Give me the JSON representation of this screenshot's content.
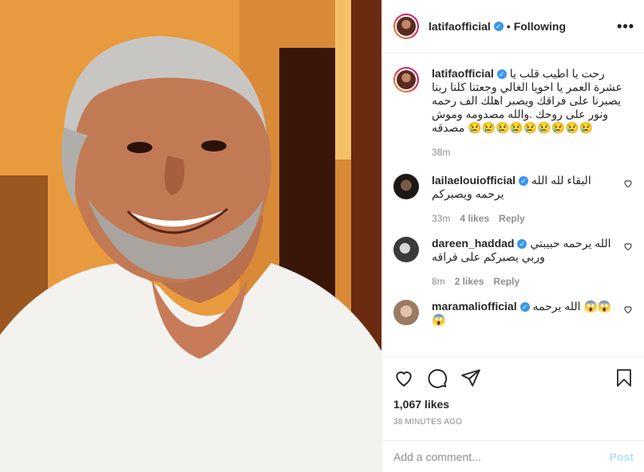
{
  "photo": {
    "description_icon": "person-photo"
  },
  "header": {
    "username": "latifaofficial",
    "verified": true,
    "separator": "•",
    "follow_label": "Following",
    "more_icon": "more-icon"
  },
  "caption": {
    "username": "latifaofficial",
    "text": "رحت يا اطيب قلب يا عشرة العمر يا اخويا الغالي وجعتنا كلنا ربنا يصبرنا على فراقك ويصبر اهلك الف رحمه ونور على روحك .والله مصدومه وموش مصدقه 😢😢😢😢😢😢😢😢😢",
    "time": "38m"
  },
  "comments": [
    {
      "username": "lailaelouiofficial",
      "text": "البقاء لله الله يرحمه ويصبركم",
      "time": "33m",
      "likes": "4 likes",
      "reply": "Reply",
      "avatar_color": "#2b2520"
    },
    {
      "username": "dareen_haddad",
      "text": "الله يرحمه حبيبتي وربي يصبركم على فراقه",
      "time": "8m",
      "likes": "2 likes",
      "reply": "Reply",
      "avatar_color": "#555555"
    },
    {
      "username": "maramaliofficial",
      "text": "الله يرحمه 😱😱 😱",
      "time": "",
      "likes": "",
      "reply": "",
      "avatar_color": "#caa890"
    }
  ],
  "actions": {
    "like_icon": "heart-icon",
    "comment_icon": "comment-icon",
    "share_icon": "share-icon",
    "save_icon": "bookmark-icon"
  },
  "likes": "1,067 likes",
  "timestamp": "38 MINUTES AGO",
  "add_comment": {
    "placeholder": "Add a comment...",
    "post_label": "Post"
  }
}
